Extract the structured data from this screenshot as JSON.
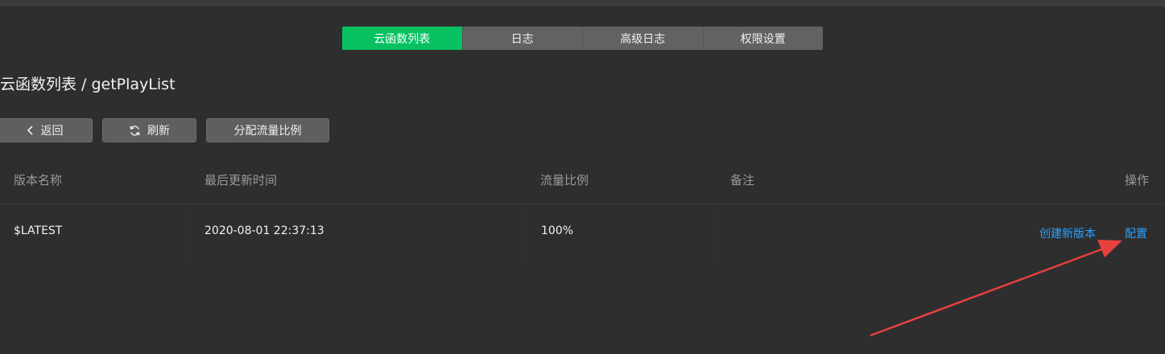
{
  "tabs": [
    {
      "label": "云函数列表",
      "active": true
    },
    {
      "label": "日志",
      "active": false
    },
    {
      "label": "高级日志",
      "active": false
    },
    {
      "label": "权限设置",
      "active": false
    }
  ],
  "breadcrumb": "云函数列表 / getPlayList",
  "toolbar": {
    "back_label": "返回",
    "refresh_label": "刷新",
    "traffic_label": "分配流量比例"
  },
  "table": {
    "headers": {
      "version": "版本名称",
      "updated": "最后更新时间",
      "traffic": "流量比例",
      "remark": "备注",
      "actions": "操作"
    },
    "rows": [
      {
        "version": "$LATEST",
        "updated": "2020-08-01 22:37:13",
        "traffic": "100%",
        "remark": "",
        "action_create": "创建新版本",
        "action_config": "配置"
      }
    ]
  },
  "colors": {
    "accent": "#07c160",
    "link": "#2aa3ff",
    "annotation_arrow": "#e8403d"
  },
  "icons": {
    "back": "chevron-left-icon",
    "refresh": "refresh-icon",
    "annotation": "arrow-annotation-icon"
  }
}
